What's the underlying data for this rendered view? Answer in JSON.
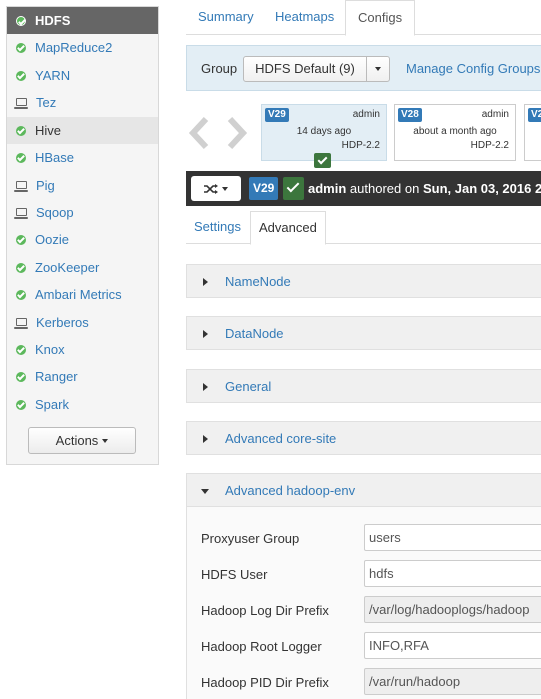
{
  "sidebar": {
    "services": [
      {
        "label": "HDFS",
        "icon": "check-circle-icon",
        "status": "ok",
        "state": "active"
      },
      {
        "label": "MapReduce2",
        "icon": "check-circle-icon",
        "status": "ok",
        "state": ""
      },
      {
        "label": "YARN",
        "icon": "check-circle-icon",
        "status": "ok",
        "state": ""
      },
      {
        "label": "Tez",
        "icon": "laptop-icon",
        "status": "client",
        "state": ""
      },
      {
        "label": "Hive",
        "icon": "check-circle-icon",
        "status": "ok",
        "state": "hover"
      },
      {
        "label": "HBase",
        "icon": "check-circle-icon",
        "status": "ok",
        "state": ""
      },
      {
        "label": "Pig",
        "icon": "laptop-icon",
        "status": "client",
        "state": ""
      },
      {
        "label": "Sqoop",
        "icon": "laptop-icon",
        "status": "client",
        "state": ""
      },
      {
        "label": "Oozie",
        "icon": "check-circle-icon",
        "status": "ok",
        "state": ""
      },
      {
        "label": "ZooKeeper",
        "icon": "check-circle-icon",
        "status": "ok",
        "state": ""
      },
      {
        "label": "Ambari Metrics",
        "icon": "check-circle-icon",
        "status": "ok",
        "state": ""
      },
      {
        "label": "Kerberos",
        "icon": "laptop-icon",
        "status": "client",
        "state": ""
      },
      {
        "label": "Knox",
        "icon": "check-circle-icon",
        "status": "ok",
        "state": ""
      },
      {
        "label": "Ranger",
        "icon": "check-circle-icon",
        "status": "ok",
        "state": ""
      },
      {
        "label": "Spark",
        "icon": "check-circle-icon",
        "status": "ok",
        "state": ""
      }
    ],
    "actions_label": "Actions"
  },
  "tabs": [
    {
      "label": "Summary",
      "active": false
    },
    {
      "label": "Heatmaps",
      "active": false
    },
    {
      "label": "Configs",
      "active": true
    }
  ],
  "group_bar": {
    "label": "Group",
    "selected": "HDFS Default (9)",
    "manage_link": "Manage Config Groups"
  },
  "versions": [
    {
      "badge": "V29",
      "author": "admin",
      "time": "14 days ago",
      "stack": "HDP-2.2",
      "current": true
    },
    {
      "badge": "V28",
      "author": "admin",
      "time": "about a month ago",
      "stack": "HDP-2.2",
      "current": false
    },
    {
      "badge": "V2",
      "author": "",
      "time": "",
      "stack": "",
      "current": false
    }
  ],
  "version_bar": {
    "badge": "V29",
    "author": "admin",
    "action_text": "authored on",
    "date": "Sun, Jan 03, 2016 2"
  },
  "subtabs": [
    {
      "label": "Settings",
      "active": false
    },
    {
      "label": "Advanced",
      "active": true
    }
  ],
  "sections": [
    {
      "title": "NameNode",
      "open": false
    },
    {
      "title": "DataNode",
      "open": false
    },
    {
      "title": "General",
      "open": false
    },
    {
      "title": "Advanced core-site",
      "open": false
    },
    {
      "title": "Advanced hadoop-env",
      "open": true
    }
  ],
  "hadoop_env": [
    {
      "label": "Proxyuser Group",
      "value": "users",
      "readonly": false
    },
    {
      "label": "HDFS User",
      "value": "hdfs",
      "readonly": false
    },
    {
      "label": "Hadoop Log Dir Prefix",
      "value": "/var/log/hadooplogs/hadoop",
      "readonly": true
    },
    {
      "label": "Hadoop Root Logger",
      "value": "INFO,RFA",
      "readonly": false
    },
    {
      "label": "Hadoop PID Dir Prefix",
      "value": "/var/run/hadoop",
      "readonly": true
    }
  ],
  "colors": {
    "link": "#337ab7",
    "ok": "#5cb85c",
    "sidebar_active": "#666666",
    "version_bar": "#333333",
    "current_version": "#e3eef5"
  }
}
